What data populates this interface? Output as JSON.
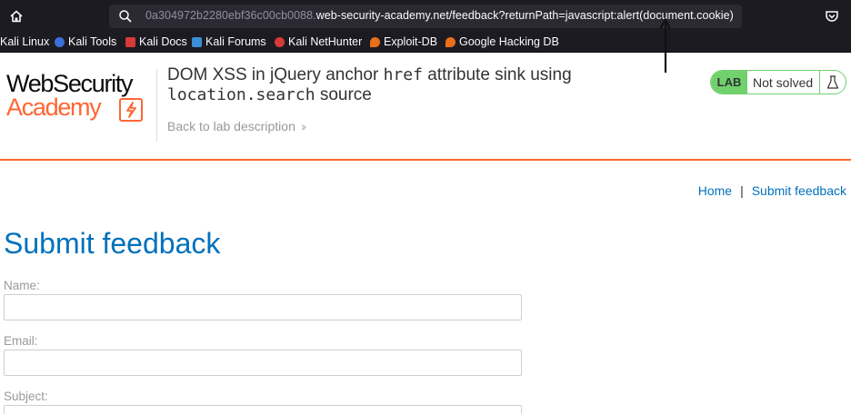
{
  "browser": {
    "url_dim": "0a304972b2280ebf36c00cb0088.",
    "url_main": "web-security-academy.net/feedback?returnPath=javascript:alert(document.cookie)",
    "bookmarks": [
      {
        "label": "Kali Linux",
        "icon": "none",
        "color": ""
      },
      {
        "label": "Kali Tools",
        "icon": "kali-tools-icon",
        "color": "#3c6fd8"
      },
      {
        "label": "Kali Docs",
        "icon": "kali-docs-icon",
        "color": "#d63a3a"
      },
      {
        "label": "Kali Forums",
        "icon": "kali-forums-icon",
        "color": "#3a8fd6"
      },
      {
        "label": "Kali NetHunter",
        "icon": "nethunter-icon",
        "color": "#d63a3a"
      },
      {
        "label": "Exploit-DB",
        "icon": "exploit-db-icon",
        "color": "#e8701a"
      },
      {
        "label": "Google Hacking DB",
        "icon": "ghdb-icon",
        "color": "#e8701a"
      }
    ]
  },
  "header": {
    "logo_line1": "WebSecurity",
    "logo_line2": "Academy",
    "title_part1": "DOM XSS in jQuery anchor ",
    "title_code1": "href",
    "title_part2": " attribute sink using",
    "title_code2": "location.search",
    "title_part3": " source",
    "back_link": "Back to lab description",
    "lab_badge": "LAB",
    "lab_status": "Not solved"
  },
  "nav": {
    "home": "Home",
    "separator": "|",
    "submit_feedback": "Submit feedback"
  },
  "form": {
    "heading": "Submit feedback",
    "name_label": "Name:",
    "email_label": "Email:",
    "subject_label": "Subject:"
  },
  "colors": {
    "accent_orange": "#ff6633",
    "link_blue": "#0071bc",
    "lab_green": "#70d16d"
  }
}
